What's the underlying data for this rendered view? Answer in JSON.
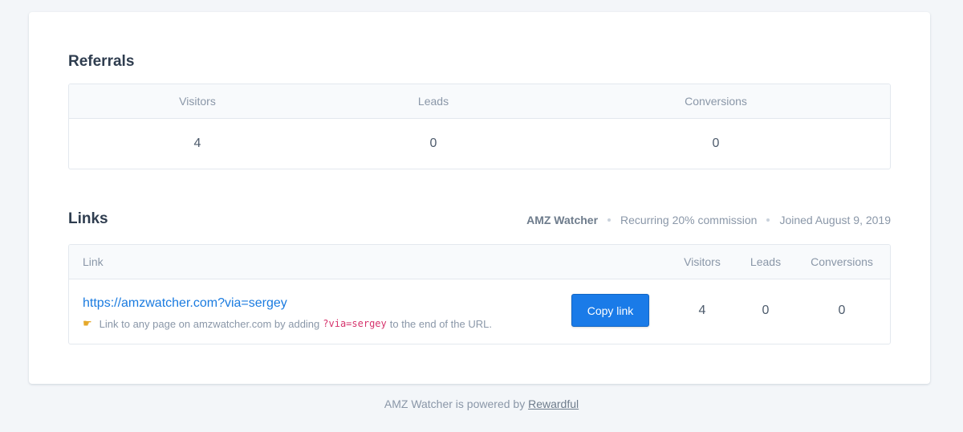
{
  "referrals": {
    "title": "Referrals",
    "columns": [
      {
        "label": "Visitors",
        "value": "4"
      },
      {
        "label": "Leads",
        "value": "0"
      },
      {
        "label": "Conversions",
        "value": "0"
      }
    ]
  },
  "links": {
    "title": "Links",
    "meta": {
      "brand": "AMZ Watcher",
      "commission": "Recurring 20% commission",
      "joined": "Joined August 9, 2019"
    },
    "headers": {
      "link": "Link",
      "visitors": "Visitors",
      "leads": "Leads",
      "conversions": "Conversions"
    },
    "rows": [
      {
        "url": "https://amzwatcher.com?via=sergey",
        "hint_icon": "pointing-hand-icon",
        "hint_prefix": "Link to any page on amzwatcher.com by adding",
        "hint_code": "?via=sergey",
        "hint_suffix": "to the end of the URL.",
        "copy_label": "Copy link",
        "visitors": "4",
        "leads": "0",
        "conversions": "0"
      }
    ]
  },
  "footer": {
    "prefix": "AMZ Watcher is powered by",
    "link": "Rewardful"
  },
  "colors": {
    "accent": "#1a7be8",
    "code": "#d6336c"
  }
}
